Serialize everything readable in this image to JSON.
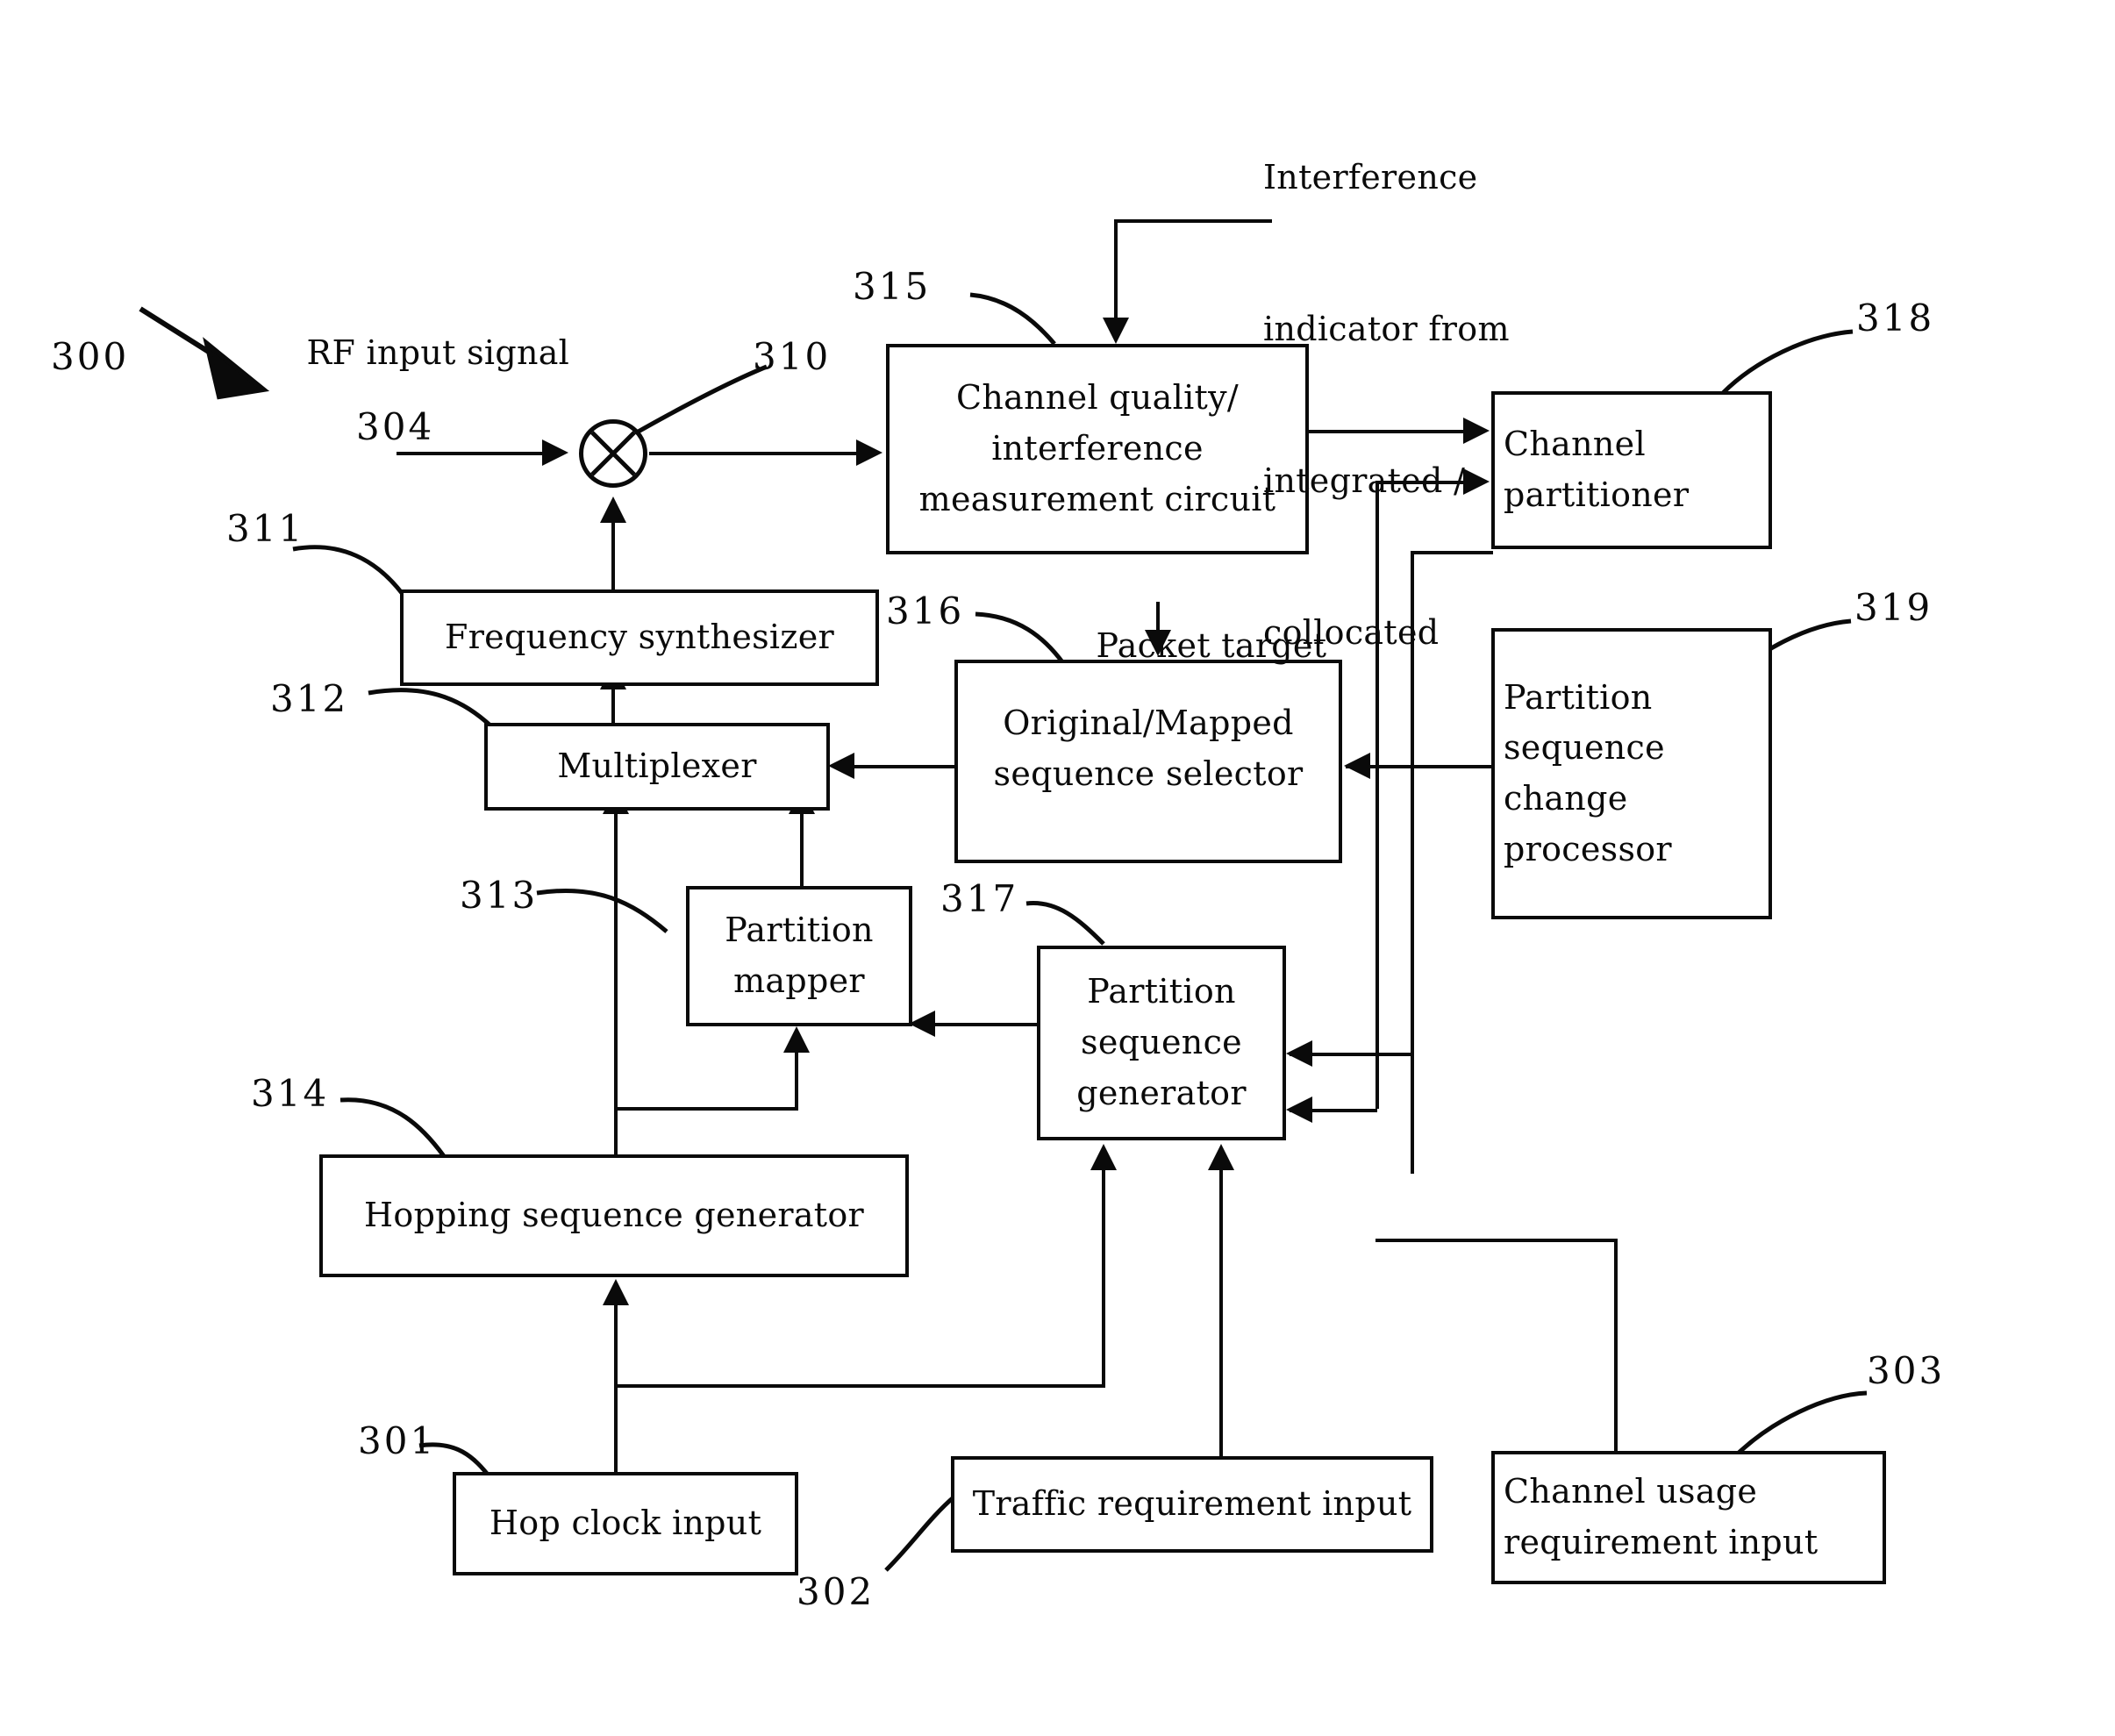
{
  "figure": {
    "kind": "patent-block-diagram",
    "overall_ref": "300",
    "annotations": {
      "rf_input_signal": "RF input signal",
      "interference_indicator": "Interference\nindicator from\nintegrated /\ncollocated",
      "packet_target": "Packet target"
    }
  },
  "blocks": {
    "channel_quality": {
      "label": "Channel quality/\ninterference\nmeasurement circuit",
      "ref": "315"
    },
    "channel_partitioner": {
      "label": "Channel\npartitioner",
      "ref": "318"
    },
    "partition_change_processor": {
      "label": "Partition\nsequence\nchange\nprocessor",
      "ref": "319"
    },
    "frequency_synthesizer": {
      "label": "Frequency synthesizer",
      "ref": "311"
    },
    "multiplexer": {
      "label": "Multiplexer",
      "ref": "312"
    },
    "sequence_selector": {
      "label": "Original/Mapped\nsequence selector",
      "ref": "316"
    },
    "partition_mapper": {
      "label": "Partition\nmapper",
      "ref": "313"
    },
    "partition_sequence_generator": {
      "label": "Partition\nsequence\ngenerator",
      "ref": "317"
    },
    "hopping_sequence_generator": {
      "label": "Hopping sequence generator",
      "ref": "314"
    },
    "hop_clock_input": {
      "label": "Hop clock input",
      "ref": "301"
    },
    "traffic_requirement_input": {
      "label": "Traffic requirement input",
      "ref": "302"
    },
    "channel_usage_input": {
      "label": "Channel usage\nrequirement input",
      "ref": "303"
    },
    "mixer": {
      "ref": "310"
    },
    "rf_input_path": {
      "ref": "304"
    }
  },
  "refs": {
    "r300": "300",
    "r301": "301",
    "r302": "302",
    "r303": "303",
    "r304": "304",
    "r310": "310",
    "r311": "311",
    "r312": "312",
    "r313": "313",
    "r314": "314",
    "r315": "315",
    "r316": "316",
    "r317": "317",
    "r318": "318",
    "r319": "319"
  },
  "block_text": {
    "channel_quality_l1": "Channel quality/",
    "channel_quality_l2": "interference",
    "channel_quality_l3": "measurement circuit",
    "channel_partitioner_l1": "Channel",
    "channel_partitioner_l2": "partitioner",
    "change_proc_l1": "Partition",
    "change_proc_l2": "sequence",
    "change_proc_l3": "change",
    "change_proc_l4": "processor",
    "frequency_synthesizer": "Frequency synthesizer",
    "multiplexer": "Multiplexer",
    "selector_l1": "Original/Mapped",
    "selector_l2": "sequence selector",
    "mapper_l1": "Partition",
    "mapper_l2": "mapper",
    "psg_l1": "Partition",
    "psg_l2": "sequence",
    "psg_l3": "generator",
    "hopping_generator": "Hopping sequence generator",
    "hop_clock": "Hop clock input",
    "traffic_input": "Traffic requirement input",
    "usage_l1": "Channel usage",
    "usage_l2": "requirement input"
  },
  "annotation_text": {
    "rf_input": "RF input signal",
    "interf_l1": "Interference",
    "interf_l2": "indicator from",
    "interf_l3": "integrated /",
    "interf_l4": "collocated",
    "packet_target": "Packet target"
  },
  "colors": {
    "ink": "#0a0a0a",
    "paper": "#ffffff"
  }
}
